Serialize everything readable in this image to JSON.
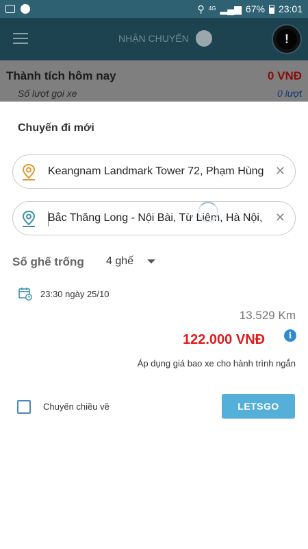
{
  "status_bar": {
    "network": "4G",
    "battery": "67%",
    "time": "23:01"
  },
  "header": {
    "toggle_label": "NHẬN CHUYẾN",
    "alert_glyph": "!"
  },
  "stats": {
    "title": "Thành tích hôm nay",
    "amount": "0 VNĐ",
    "trips_label": "Số lượt gọi xe",
    "trips_value": "0 lượt"
  },
  "trip_form": {
    "title": "Chuyến đi mới",
    "pickup": {
      "value": "Keangnam Landmark Tower 72, Phạm Hùng",
      "clear_glyph": "✕"
    },
    "dropoff": {
      "value": "Bắc Thăng Long - Nội Bài, Từ Liêm, Hà Nội,",
      "clear_glyph": "✕"
    },
    "seats": {
      "label": "Số ghế trống",
      "value": "4 ghế"
    },
    "datetime": "23:30 ngày 25/10",
    "distance": "13.529 Km",
    "price": "122.000 VNĐ",
    "info_glyph": "i",
    "price_note": "Áp dụng giá bao xe cho hành trình ngắn",
    "return_trip_label": "Chuyến chiều về",
    "return_trip_checked": false,
    "submit_label": "LETSGO"
  },
  "colors": {
    "header_bg": "#1d4350",
    "price": "#e01b1b",
    "button": "#55b0d9",
    "pickup_pin": "#e09a2b",
    "dropoff_pin": "#3c8fa8"
  },
  "icons": {
    "pickup": "location-pin-icon",
    "dropoff": "location-pin-icon",
    "calendar": "calendar-clock-icon",
    "info": "info-icon",
    "menu": "hamburger-menu-icon",
    "alert": "alert-icon"
  }
}
